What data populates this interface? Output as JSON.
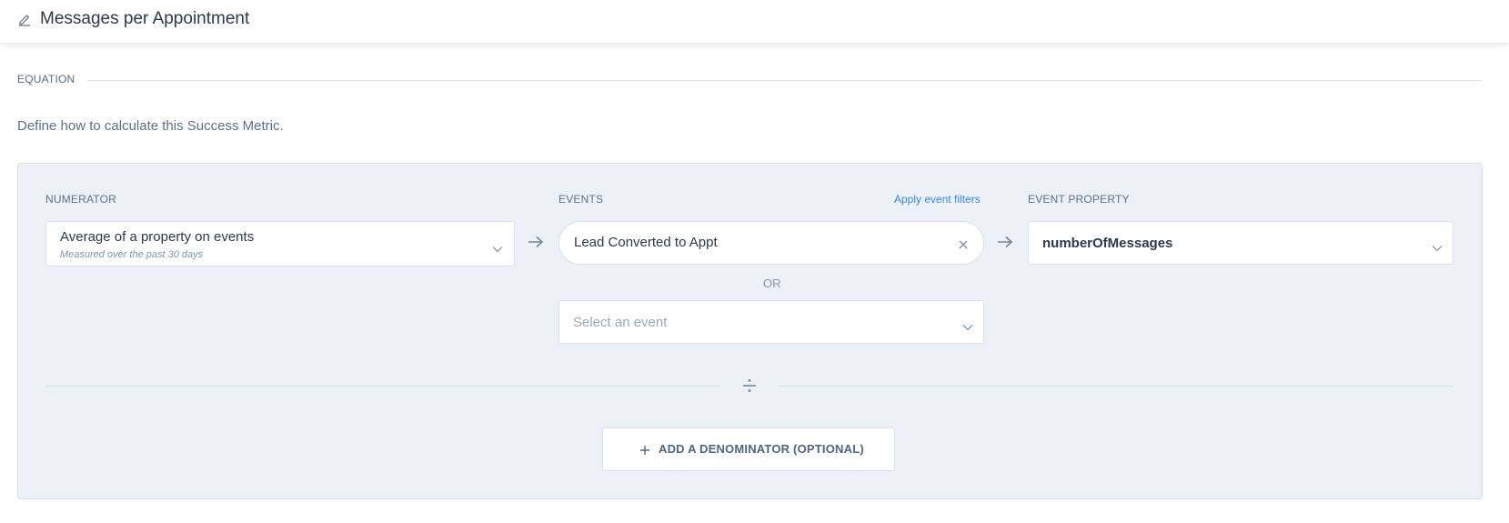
{
  "header": {
    "title": "Messages per Appointment",
    "edit_icon": "pencil-icon"
  },
  "equation": {
    "section_label": "EQUATION",
    "description": "Define how to calculate this Success Metric."
  },
  "numerator": {
    "label": "NUMERATOR",
    "selected": "Average of a property on events",
    "subtext": "Measured over the past 30 days"
  },
  "events": {
    "label": "EVENTS",
    "apply_filters_link": "Apply event filters",
    "selected_event": "Lead Converted to Appt",
    "or_text": "OR",
    "select_placeholder": "Select an event"
  },
  "event_property": {
    "label": "EVENT PROPERTY",
    "selected": "numberOfMessages"
  },
  "denominator": {
    "add_button_label": "ADD A DENOMINATOR (OPTIONAL)"
  },
  "colors": {
    "panel_bg": "#ecf1f8",
    "link": "#3b86d6",
    "label": "#5b7189",
    "text": "#2b3a4a"
  }
}
